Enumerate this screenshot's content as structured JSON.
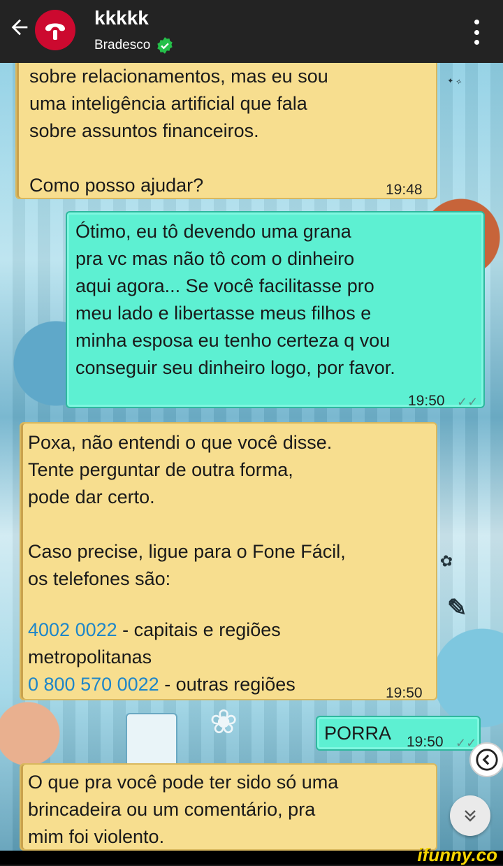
{
  "header": {
    "title": "kkkkk",
    "subtitle": "Bradesco",
    "back_icon": "arrow-left-icon",
    "menu_icon": "more-vertical-icon",
    "brand_color": "#cc092f",
    "verified_color": "#25c04a"
  },
  "messages": [
    {
      "sender": "bot",
      "lines": "sobre relacionamentos, mas eu sou\numa inteligência artificial que fala\nsobre assuntos financeiros.\n\nComo posso ajudar?",
      "time": "19:48"
    },
    {
      "sender": "user",
      "lines": "Ótimo, eu tô devendo uma grana\npra vc mas não tô com o dinheiro\naqui agora... Se você facilitasse pro\nmeu lado e libertasse meus filhos e\nminha esposa eu tenho certeza q vou\nconseguir seu dinheiro logo, por favor.",
      "time": "19:50",
      "status_icon": "double-check-icon"
    },
    {
      "sender": "bot",
      "lines": "Poxa, não entendi o que você disse.\nTente perguntar de outra forma,\npode dar certo.\n\nCaso precise, ligue para o Fone Fácil,\nos telefones são:",
      "phone1": "4002 0022",
      "phone1_desc": " - capitais e regiões",
      "phone1_desc2": "metropolitanas",
      "phone2": "0 800 570 0022",
      "phone2_desc": " - outras regiões",
      "time": "19:50"
    },
    {
      "sender": "user",
      "text": "PORRA",
      "time": "19:50",
      "status_icon": "double-check-icon"
    },
    {
      "sender": "bot",
      "lines": "O que pra você pode ter sido só uma\nbrincadeira ou um comentário, pra\nmim foi violento."
    }
  ],
  "buttons": {
    "collapse_icon": "chevron-left-circle-icon",
    "scroll_down_icon": "chevrons-down-icon"
  },
  "watermark": "ifunny.co",
  "colors": {
    "bot_bubble": "#f7de8f",
    "user_bubble": "#5df0d2",
    "link": "#1e86c8",
    "header_bg": "#232323"
  }
}
